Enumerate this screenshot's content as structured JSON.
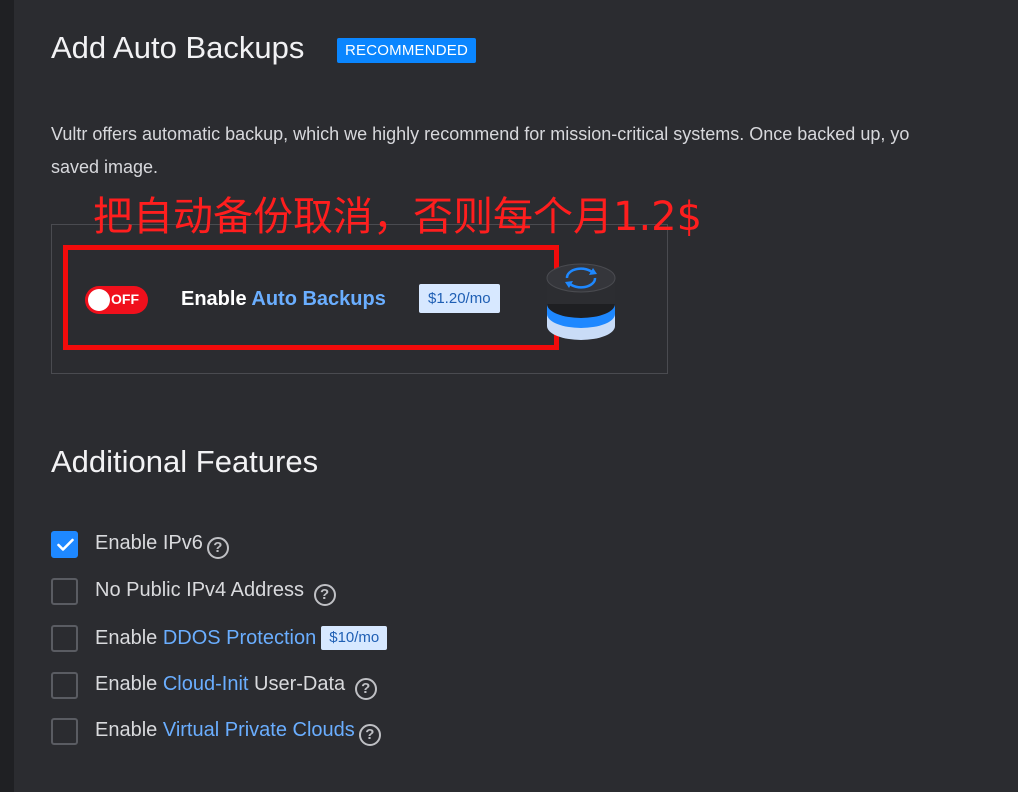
{
  "backups": {
    "title": "Add Auto Backups",
    "badge": "RECOMMENDED",
    "description": "Vultr offers automatic backup, which we highly recommend for mission-critical systems. Once backed up, yo",
    "description_line2": "saved image.",
    "annotation": "把自动备份取消，否则每个月1.2$",
    "toggle_state": "OFF",
    "label_prefix": "Enable ",
    "label_link": "Auto Backups",
    "price": "$1.20/mo",
    "illustration_icon": "backup-disk-icon"
  },
  "features": {
    "title": "Additional Features",
    "items": [
      {
        "prefix": "Enable IPv6",
        "link": "",
        "suffix": "",
        "checked": true,
        "help": "?",
        "price": ""
      },
      {
        "prefix": "No Public IPv4 Address",
        "link": "",
        "suffix": "",
        "checked": false,
        "help": "?",
        "price": ""
      },
      {
        "prefix": "Enable ",
        "link": "DDOS Protection",
        "suffix": "",
        "checked": false,
        "help": "",
        "price": "$10/mo"
      },
      {
        "prefix": "Enable ",
        "link": "Cloud-Init",
        "suffix": " User-Data",
        "checked": false,
        "help": "?",
        "price": ""
      },
      {
        "prefix": "Enable ",
        "link": "Virtual Private Clouds",
        "suffix": "",
        "checked": false,
        "help": "?",
        "price": ""
      }
    ]
  },
  "colors": {
    "background": "#2b2c30",
    "accent": "#0a86ff",
    "link": "#6aaeff",
    "toggle_off": "#f0101c",
    "annotation": "#ff1e1e"
  }
}
